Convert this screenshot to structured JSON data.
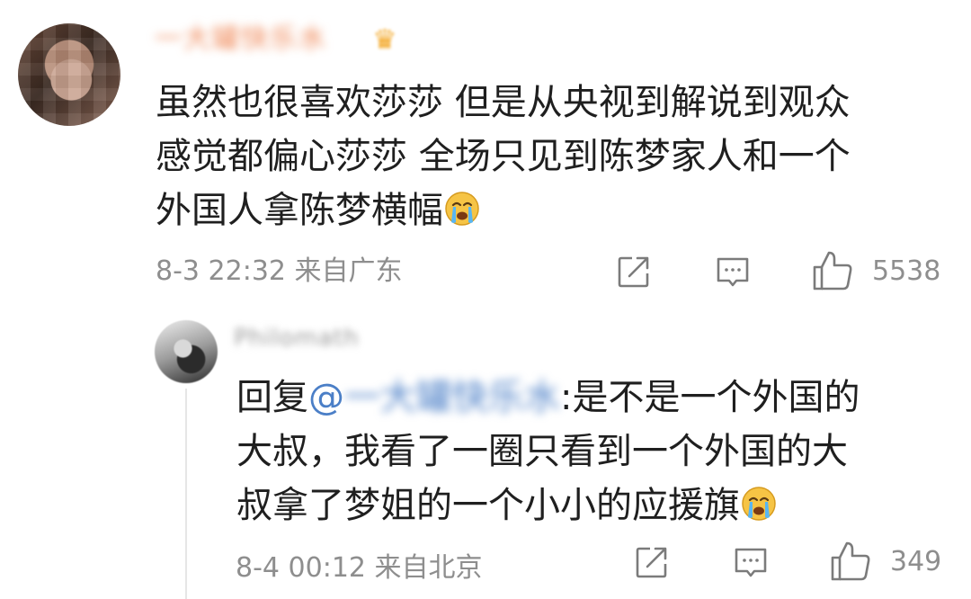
{
  "comment": {
    "username": "一大罐快乐水",
    "crown_icon": "crown-icon",
    "text_lines": [
      "虽然也很喜欢莎莎 但是从央视到解说到观众",
      "感觉都偏心莎莎 全场只见到陈梦家人和一个",
      "外国人拿陈梦横幅"
    ],
    "emoji": "crying-emoji",
    "time": "8-3 22:32",
    "location": "来自广东",
    "like_count": "5538"
  },
  "reply": {
    "username": "Philomath",
    "prefix": "回复",
    "mention_at": "@",
    "mention_name": "一大罐快乐水",
    "text_first": ":是不是一个外国的",
    "text_lines": [
      "大叔，我看了一圈只看到一个外国的大",
      "叔拿了梦姐的一个小小的应援旗"
    ],
    "emoji": "crying-emoji",
    "time": "8-4 00:12",
    "location": "来自北京",
    "like_count": "349"
  },
  "colors": {
    "username": "#f08a5a",
    "text": "#1f1f1f",
    "meta": "#8e8e8e",
    "mention": "#4b7fc7"
  }
}
